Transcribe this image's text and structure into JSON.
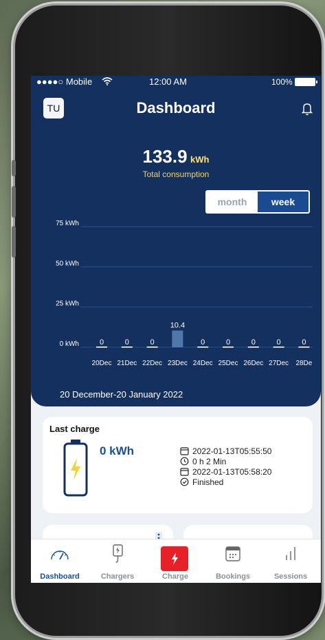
{
  "status_bar": {
    "carrier": "●●●●○ Mobile",
    "time": "12:00 AM",
    "battery": "100%"
  },
  "header": {
    "avatar": "TU",
    "title": "Dashboard"
  },
  "total": {
    "value": "133.9",
    "unit": "kWh",
    "label": "Total consumption"
  },
  "toggle": {
    "month": "month",
    "week": "week",
    "selected": "week"
  },
  "chart_data": {
    "type": "bar",
    "categories": [
      "20Dec",
      "21Dec",
      "22Dec",
      "23Dec",
      "24Dec",
      "25Dec",
      "26Dec",
      "27Dec",
      "28De"
    ],
    "values": [
      0,
      0,
      0,
      10.4,
      0,
      0,
      0,
      0,
      0
    ],
    "value_labels": [
      "0",
      "0",
      "0",
      "10.4",
      "0",
      "0",
      "0",
      "0",
      "0"
    ],
    "y_ticks": [
      "0 kWh",
      "25 kWh",
      "50 kWh",
      "75 kWh"
    ],
    "ylim": [
      0,
      75
    ],
    "grid": true
  },
  "date_range": "20 December-20 January 2022",
  "last_charge": {
    "title": "Last charge",
    "energy": "0 kWh",
    "start": "2022-01-13T05:55:50",
    "duration": "0 h 2 Min",
    "end": "2022-01-13T05:58:20",
    "status": "Finished"
  },
  "nav": [
    {
      "label": "Dashboard",
      "icon": "gauge-icon"
    },
    {
      "label": "Chargers",
      "icon": "charger-plug-icon"
    },
    {
      "label": "Charge",
      "icon": "lightning-icon"
    },
    {
      "label": "Bookings",
      "icon": "calendar-icon"
    },
    {
      "label": "Sessions",
      "icon": "bar-chart-icon"
    }
  ],
  "colors": {
    "primary": "#13305f",
    "accent": "#1a4e9c",
    "charge": "#e8202a",
    "highlight": "#ffe36b"
  }
}
